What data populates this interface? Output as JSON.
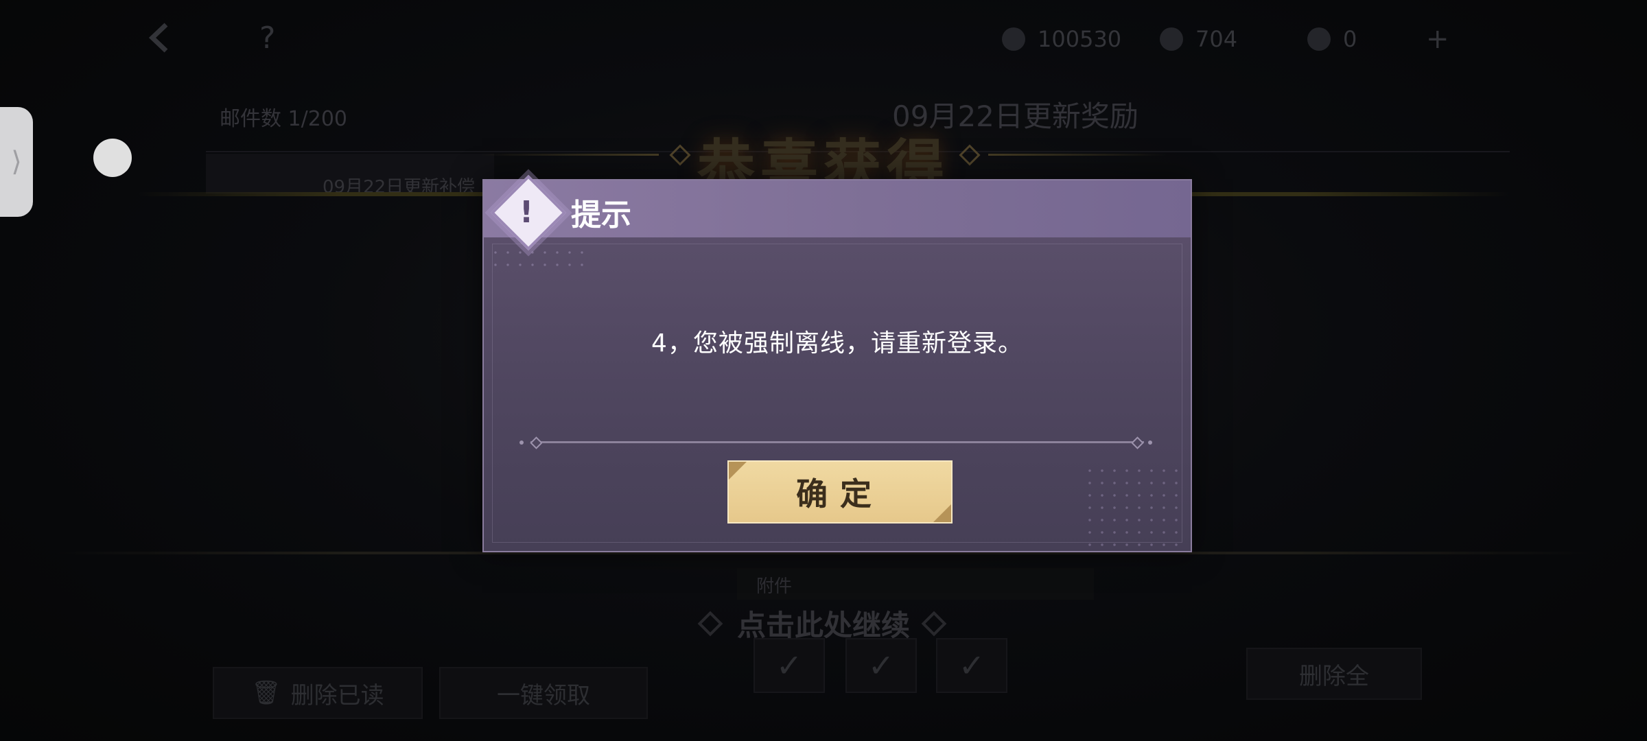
{
  "background": {
    "help_glyph": "?",
    "currencies": [
      {
        "icon": "gold-coin-icon",
        "value": "100530"
      },
      {
        "icon": "gem-icon",
        "value": "704"
      },
      {
        "icon": "crystal-icon",
        "value": "0"
      }
    ],
    "plus_glyph": "+",
    "side_tab_glyph": "⟩",
    "panel_left_label": "邮件数 1/200",
    "panel_right_label": "09月22日更新奖励",
    "panel_sub_label": "09月22日更新补偿",
    "congrats_title": "恭喜获得",
    "mid_label": "附件",
    "continue_text": "点击此处继续",
    "check_glyph": "✓",
    "buttons": {
      "delete_read": "删除已读",
      "claim_all": "一键领取",
      "delete_all": "删除全"
    }
  },
  "dialog": {
    "title": "提示",
    "emblem_glyph": "!",
    "message": "4，您被强制离线，请重新登录。",
    "confirm_label": "确定"
  },
  "colors": {
    "dialog_header": "#8b7aa2",
    "dialog_body": "#5e526e",
    "confirm_button": "#f0d9a2",
    "confirm_text": "#3b2e1c"
  }
}
